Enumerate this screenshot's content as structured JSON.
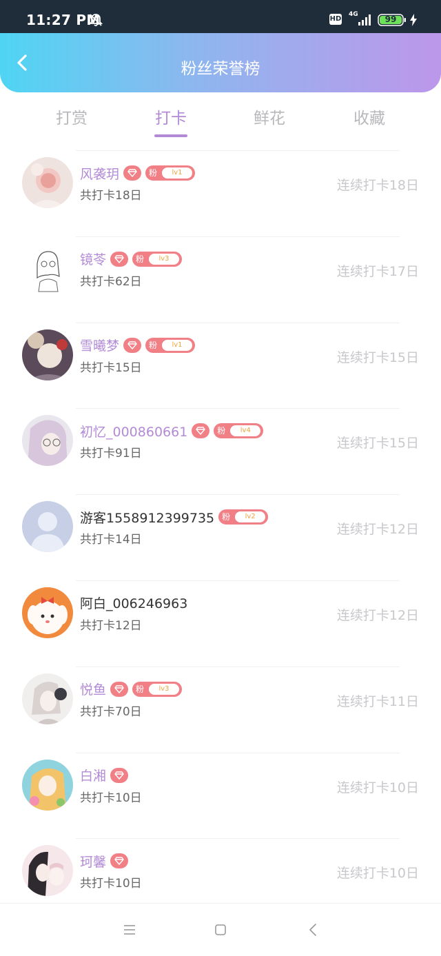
{
  "status_bar": {
    "time": "11:27 PM",
    "hd": "HD",
    "network": "4G",
    "battery": "99",
    "icons": [
      "bell-off-icon",
      "signal-icon",
      "battery-icon",
      "charging-icon"
    ]
  },
  "header": {
    "title": "粉丝荣誉榜",
    "back_icon": "chevron-left-icon",
    "gradient": [
      "#4fd5f3",
      "#bd97ea"
    ]
  },
  "tabs": [
    {
      "label": "打赏",
      "active": false
    },
    {
      "label": "打卡",
      "active": true
    },
    {
      "label": "鲜花",
      "active": false
    },
    {
      "label": "收藏",
      "active": false
    }
  ],
  "colors": {
    "accent": "#b38ad6",
    "badge": "#f17f86",
    "muted": "#c8c8cc"
  },
  "list": [
    {
      "name": "风袭玥",
      "diamond": true,
      "fan_char": "粉",
      "fan_level": "lv1",
      "total": "共打卡18日",
      "streak": "连续打卡18日"
    },
    {
      "name": "镜苓",
      "diamond": true,
      "fan_char": "粉",
      "fan_level": "lv3",
      "total": "共打卡62日",
      "streak": "连续打卡17日"
    },
    {
      "name": "雪曦梦",
      "diamond": true,
      "fan_char": "粉",
      "fan_level": "lv1",
      "total": "共打卡15日",
      "streak": "连续打卡15日"
    },
    {
      "name": "初忆_000860661",
      "diamond": true,
      "fan_char": "粉",
      "fan_level": "lv4",
      "total": "共打卡91日",
      "streak": "连续打卡15日"
    },
    {
      "name": "游客1558912399735",
      "diamond": false,
      "fan_char": "粉",
      "fan_level": "lv2",
      "total": "共打卡14日",
      "streak": "连续打卡12日"
    },
    {
      "name": "阿白_006246963",
      "diamond": false,
      "fan_char": "",
      "fan_level": "",
      "total": "共打卡12日",
      "streak": "连续打卡12日"
    },
    {
      "name": "悦鱼",
      "diamond": true,
      "fan_char": "粉",
      "fan_level": "lv3",
      "total": "共打卡70日",
      "streak": "连续打卡11日"
    },
    {
      "name": "白湘",
      "diamond": true,
      "fan_char": "",
      "fan_level": "",
      "total": "共打卡10日",
      "streak": "连续打卡10日"
    },
    {
      "name": "珂馨",
      "diamond": true,
      "fan_char": "",
      "fan_level": "",
      "total": "共打卡10日",
      "streak": "连续打卡10日"
    }
  ],
  "navbar": {
    "icons": [
      "menu-icon",
      "home-icon",
      "back-icon"
    ]
  }
}
